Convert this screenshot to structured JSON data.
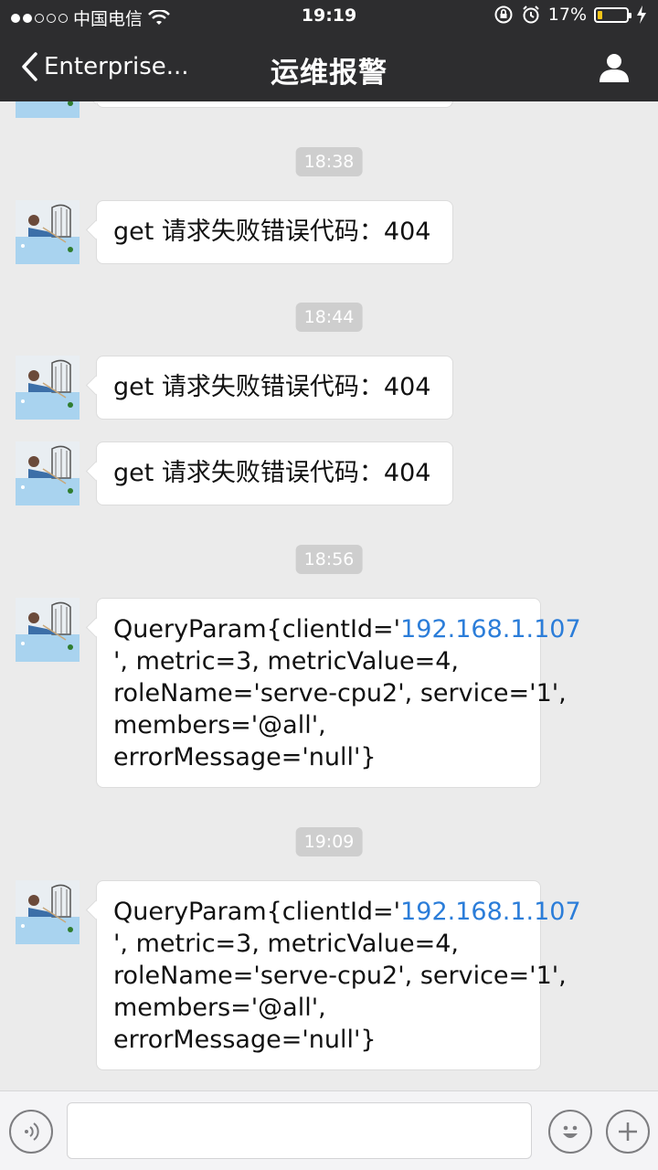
{
  "status_bar": {
    "carrier": "中国电信",
    "time": "19:19",
    "battery_percent_text": "17%",
    "battery_level": 0.17
  },
  "nav": {
    "back_label": "Enterprise...",
    "title": "运维报警"
  },
  "timestamps": [
    "18:38",
    "18:44",
    "18:56",
    "19:09"
  ],
  "messages": [
    {
      "text": "get 请求失败错误代码：404"
    },
    {
      "text": "get 请求失败错误代码：404"
    },
    {
      "text": "get 请求失败错误代码：404"
    },
    {
      "prefix": "QueryParam{clientId='",
      "link": "192.168.1.107",
      "lines": [
        "', metric=3, metricValue=4,",
        "roleName='serve-cpu2', service='1',",
        "members='@all',",
        "errorMessage='null'}"
      ]
    },
    {
      "prefix": "QueryParam{clientId='",
      "link": "192.168.1.107",
      "lines": [
        "', metric=3, metricValue=4,",
        "roleName='serve-cpu2', service='1',",
        "members='@all',",
        "errorMessage='null'}"
      ]
    }
  ],
  "input": {
    "value": "",
    "placeholder": ""
  },
  "colors": {
    "nav_background": "#2d2d2f",
    "chat_background": "#ebebeb",
    "link": "#2b7dd9",
    "battery": "#f5c518"
  },
  "icons": [
    "back-chevron-icon",
    "profile-icon",
    "voice-icon",
    "emoji-icon",
    "plus-icon",
    "wifi-icon",
    "alarm-icon",
    "rotation-lock-icon",
    "charging-icon"
  ]
}
